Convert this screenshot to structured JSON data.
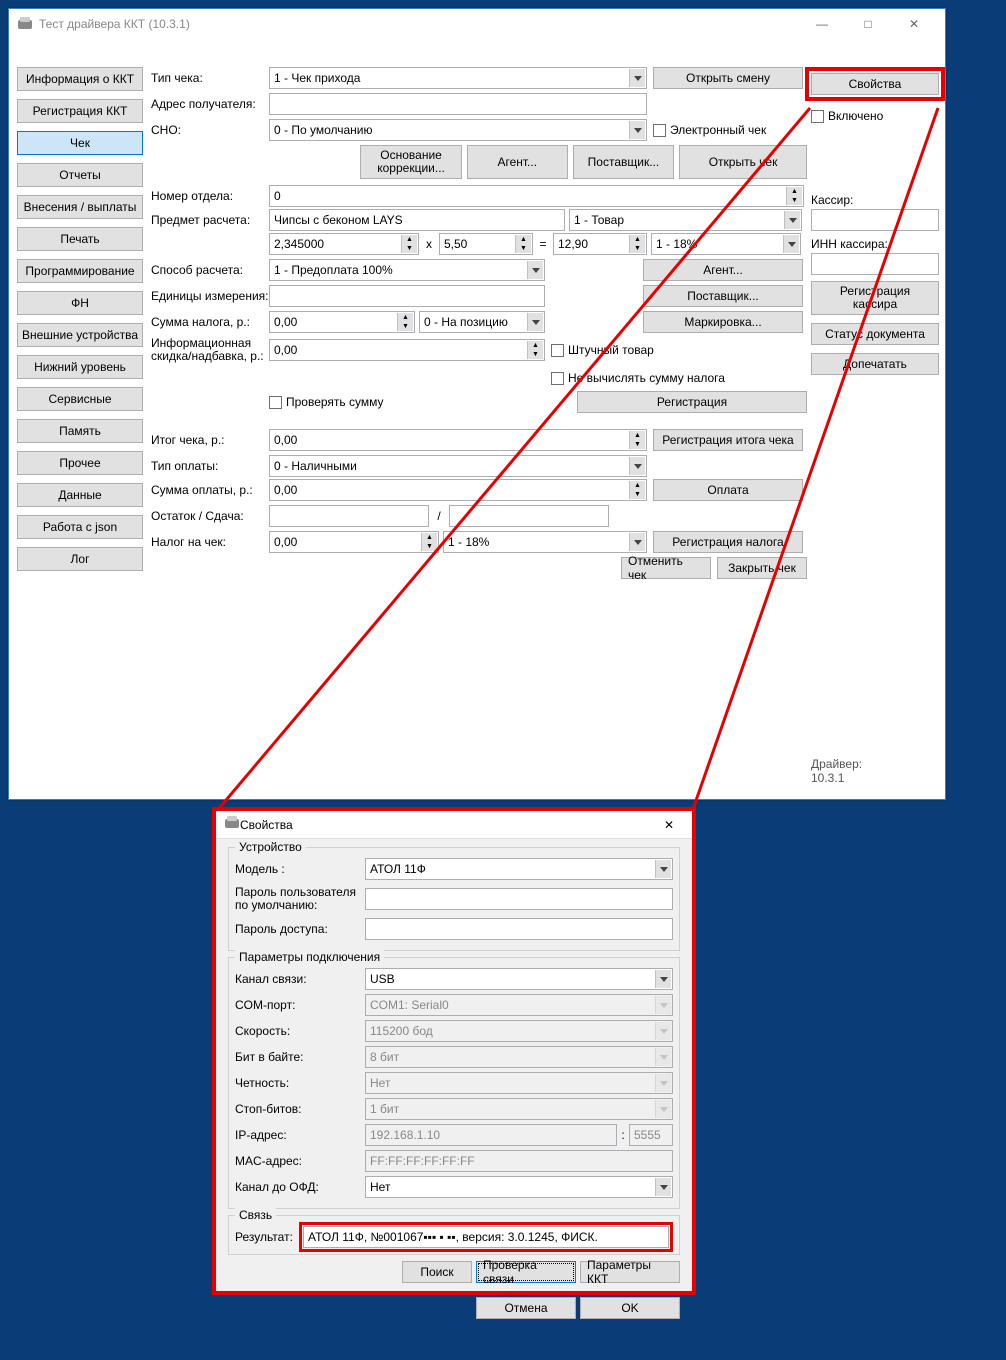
{
  "window": {
    "title": "Тест драйвера ККТ (10.3.1)",
    "min": "—",
    "max": "□",
    "close": "✕"
  },
  "tabs": [
    "Информация о ККТ",
    "Регистрация ККТ",
    "Чек",
    "Отчеты",
    "Внесения / выплаты",
    "Печать",
    "Программирование",
    "ФН",
    "Внешние устройства",
    "Нижний уровень",
    "Сервисные",
    "Память",
    "Прочее",
    "Данные",
    "Работа с json",
    "Лог"
  ],
  "active_tab_index": 2,
  "form": {
    "check_type_label": "Тип чека:",
    "check_type_value": "1 - Чек прихода",
    "open_shift": "Открыть смену",
    "recipient_label": "Адрес получателя:",
    "recipient_value": "",
    "sno_label": "СНО:",
    "sno_value": "0 - По умолчанию",
    "electronic_check": "Электронный чек",
    "correction_basis": "Основание\nкоррекции...",
    "agent": "Агент...",
    "supplier": "Поставщик...",
    "open_check": "Открыть чек",
    "dept_label": "Номер отдела:",
    "dept_value": "0",
    "item_label": "Предмет расчета:",
    "item_value": "Чипсы с беконом LAYS",
    "item_type": "1 - Товар",
    "qty": "2,345000",
    "price": "5,50",
    "sum": "12,90",
    "tax": "1 - 18%",
    "x": "x",
    "eq": "=",
    "pay_method_label": "Способ расчета:",
    "pay_method_value": "1 - Предоплата 100%",
    "agent2": "Агент...",
    "unit_label": "Единицы измерения:",
    "supplier2": "Поставщик...",
    "tax_sum_label": "Сумма налога, р.:",
    "tax_sum_value": "0,00",
    "tax_mode": "0 - На позицию",
    "marking": "Маркировка...",
    "info_discount_label": "Информационная скидка/надбавка, р.:",
    "info_discount_value": "0,00",
    "piece_goods": "Штучный товар",
    "no_tax_calc": "Не вычислять сумму налога",
    "check_sum": "Проверять сумму",
    "registration": "Регистрация",
    "total_label": "Итог чека, р.:",
    "total_value": "0,00",
    "reg_total": "Регистрация итога чека",
    "pay_type_label": "Тип оплаты:",
    "pay_type_value": "0 - Наличными",
    "pay_sum_label": "Сумма оплаты, р.:",
    "pay_sum_value": "0,00",
    "payment": "Оплата",
    "change_label": "Остаток / Сдача:",
    "slash": "/",
    "check_tax_label": "Налог на чек:",
    "check_tax_value": "0,00",
    "check_tax_rate": "1 - 18%",
    "reg_tax": "Регистрация налога",
    "cancel_check": "Отменить чек",
    "close_check": "Закрыть чек"
  },
  "right": {
    "properties": "Свойства",
    "enabled": "Включено",
    "cashier_label": "Кассир:",
    "cashier_inn_label": "ИНН кассира:",
    "reg_cashier": "Регистрация\nкассира",
    "doc_status": "Статус документа",
    "reprint": "Допечатать",
    "driver_label": "Драйвер:",
    "driver_version": "10.3.1"
  },
  "props": {
    "title": "Свойства",
    "close": "✕",
    "group_device": "Устройство",
    "model_label": "Модель :",
    "model_value": "АТОЛ 11Ф",
    "user_pwd_label": "Пароль пользователя по умолчанию:",
    "access_pwd_label": "Пароль доступа:",
    "group_conn": "Параметры подключения",
    "channel_label": "Канал связи:",
    "channel_value": "USB",
    "com_label": "COM-порт:",
    "com_value": "COM1: Serial0",
    "speed_label": "Скорость:",
    "speed_value": "115200 бод",
    "bits_label": "Бит в байте:",
    "bits_value": "8 бит",
    "parity_label": "Четность:",
    "parity_value": "Нет",
    "stop_label": "Стоп-битов:",
    "stop_value": "1 бит",
    "ip_label": "IP-адрес:",
    "ip_value": "192.168.1.10",
    "ip_port_sep": ":",
    "ip_port": "5555",
    "mac_label": "MAC-адрес:",
    "mac_value": "FF:FF:FF:FF:FF:FF",
    "ofd_label": "Канал до ОФД:",
    "ofd_value": "Нет",
    "group_link": "Связь",
    "result_label": "Результат:",
    "result_value": "АТОЛ 11Ф, №001067▪▪▪ ▪ ▪▪, версия: 3.0.1245, ФИСК.",
    "search": "Поиск",
    "check_link": "Проверка связи",
    "kkt_params": "Параметры ККТ",
    "cancel": "Отмена",
    "ok": "OK"
  }
}
